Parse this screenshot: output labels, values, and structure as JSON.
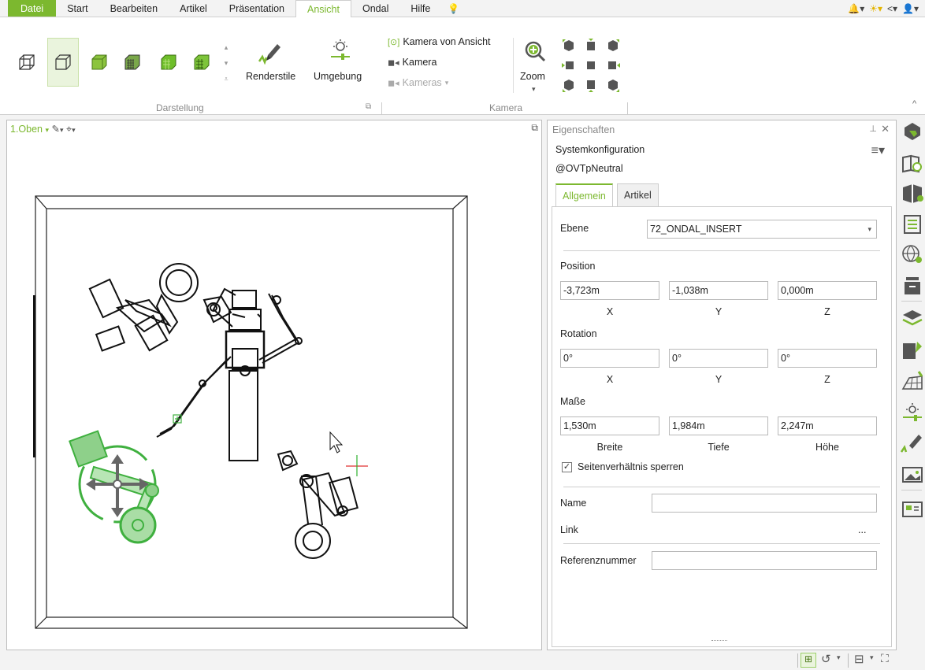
{
  "menu": {
    "tabs": [
      "Datei",
      "Start",
      "Bearbeiten",
      "Artikel",
      "Präsentation",
      "Ansicht",
      "Ondal",
      "Hilfe"
    ],
    "active": "Ansicht"
  },
  "ribbon": {
    "darstellung_label": "Darstellung",
    "kamera_label": "Kamera",
    "renderstile": "Renderstile",
    "umgebung": "Umgebung",
    "kamera_von_ansicht": "Kamera von Ansicht",
    "kamera": "Kamera",
    "kameras": "Kameras",
    "zoom": "Zoom"
  },
  "viewport": {
    "view_name": "1.Oben"
  },
  "panel": {
    "title": "Eigenschaften",
    "config": "Systemkonfiguration",
    "item": "@OVTpNeutral",
    "tabs": [
      "Allgemein",
      "Artikel"
    ],
    "ebene_label": "Ebene",
    "ebene_value": "72_ONDAL_INSERT",
    "position_label": "Position",
    "position": [
      "-3,723m",
      "-1,038m",
      "0,000m"
    ],
    "rotation_label": "Rotation",
    "rotation": [
      "0°",
      "0°",
      "0°"
    ],
    "masse_label": "Maße",
    "masse": [
      "1,530m",
      "1,984m",
      "2,247m"
    ],
    "axis_xyz": [
      "X",
      "Y",
      "Z"
    ],
    "axis_dims": [
      "Breite",
      "Tiefe",
      "Höhe"
    ],
    "lock_label": "Seitenverhältnis sperren",
    "name_label": "Name",
    "link_label": "Link",
    "link_dots": "...",
    "ref_label": "Referenznummer"
  },
  "colors": {
    "accent": "#7cb82f",
    "selected_green": "#3fb03f"
  }
}
